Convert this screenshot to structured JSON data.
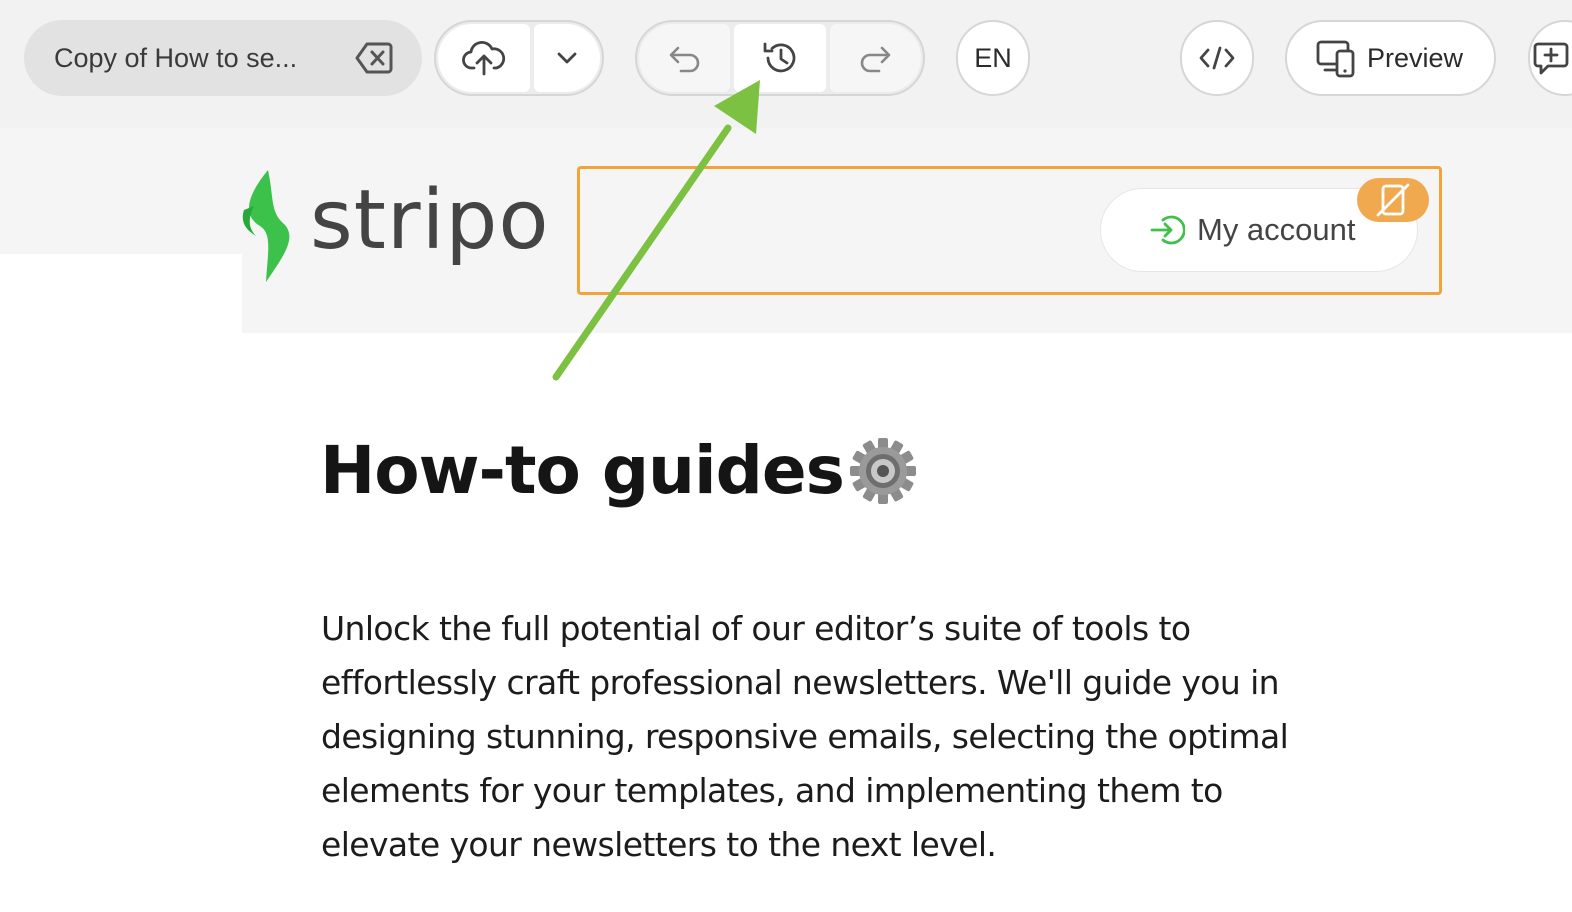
{
  "toolbar": {
    "template_title": "Copy of How to se...",
    "clear_title_icon": "backspace-clear-icon",
    "save_icon": "cloud-upload-icon",
    "save_menu_icon": "chevron-down-icon",
    "undo_icon": "undo-icon",
    "history_icon": "version-history-icon",
    "redo_icon": "redo-icon",
    "language": "EN",
    "code_icon": "code-icon",
    "preview_icon": "devices-icon",
    "preview_label": "Preview",
    "extra_icon": "add-comment-icon"
  },
  "email": {
    "logo_text": "stripo",
    "account_icon": "login-arrow-icon",
    "account_label": "My account",
    "block_badge_icon": "hide-on-mobile-icon",
    "heading": "How-to guides",
    "heading_icon": "gear-icon",
    "body": "Unlock the full potential of our editor’s suite of tools to effortlessly craft professional newsletters. We'll guide you in designing stunning, responsive emails, selecting the optimal elements for your templates, and implementing them to elevate your newsletters to the next level."
  },
  "annotation": {
    "arrow_icon": "green-arrow-annotation",
    "arrow_color": "#7cc142"
  },
  "colors": {
    "selection_outline": "#f0a43a",
    "brand_green": "#3cc14a",
    "toolbar_bg": "#f2f2f2"
  }
}
